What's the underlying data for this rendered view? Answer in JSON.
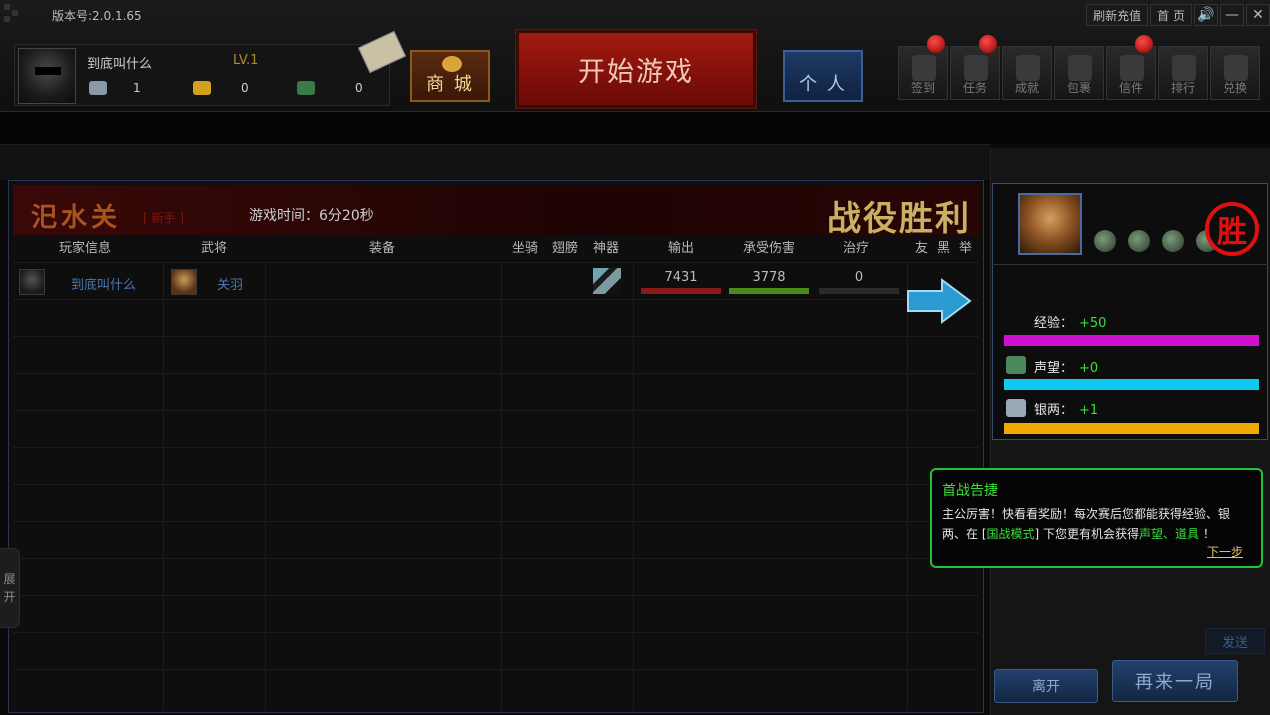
{
  "app": {
    "version": "版本号:2.0.1.65"
  },
  "window_buttons": {
    "recharge": "刷新充值",
    "home": "首 页",
    "sound": "🔊",
    "minimize": "—",
    "close": "✕"
  },
  "profile": {
    "name": "到底叫什么",
    "level": "LV.1",
    "silver": "1",
    "gold": "0",
    "jade": "0"
  },
  "nav": {
    "shop": "商 城",
    "start": "开始游戏",
    "personal": "个 人",
    "menu": [
      "签到",
      "任务",
      "成就",
      "包裹",
      "信件",
      "排行",
      "兑换"
    ]
  },
  "battle": {
    "map": "汜水关",
    "map_tag": "[ 新手 ]",
    "time": "游戏时间：6分20秒",
    "result": "战役胜利",
    "columns": [
      "玩家信息",
      "武将",
      "装备",
      "坐骑",
      "翅膀",
      "神器",
      "输出",
      "承受伤害",
      "治疗",
      "友",
      "黑",
      "举"
    ],
    "rows": [
      {
        "player": "到底叫什么",
        "general": "关羽",
        "output": "7431",
        "damage_taken": "3778",
        "heal": "0"
      }
    ]
  },
  "side_tab": {
    "line1": "展",
    "line2": "开"
  },
  "reward": {
    "seal": "胜",
    "exp_label": "经验：",
    "exp_value": "+50",
    "rep_label": "声望：",
    "rep_value": "+0",
    "silver_label": "银两：",
    "silver_value": "+1",
    "colors": {
      "exp": "#d010d0",
      "rep": "#10c8f0",
      "silver": "#f0a800"
    }
  },
  "tip": {
    "title": "首战告捷",
    "line1": "主公厉害！快看看奖励！每次赛后您都能获得经验、银",
    "line2_a": "两、在 [",
    "line2_mode": "国战模式",
    "line2_b": "] 下您更有机会获得",
    "line2_hl": "声望、道具",
    "line2_end": " ！",
    "next": "下一步"
  },
  "buttons": {
    "send": "发送",
    "leave": "离开",
    "again": "再来一局"
  }
}
